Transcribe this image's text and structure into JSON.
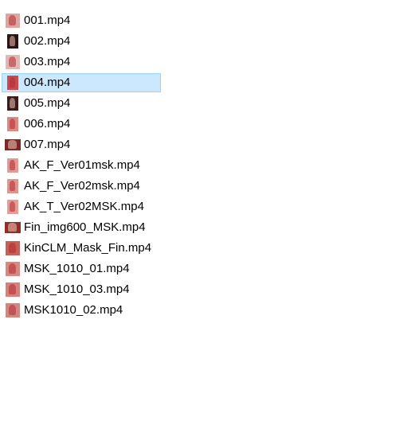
{
  "files": [
    {
      "name": "001.mp4",
      "thumb": "video-thumbnail",
      "thumb_color": "#e0a59e",
      "thumb_style": "square",
      "selected": false
    },
    {
      "name": "002.mp4",
      "thumb": "video-thumbnail",
      "thumb_color": "#2a1412",
      "thumb_style": "tall",
      "selected": false
    },
    {
      "name": "003.mp4",
      "thumb": "video-thumbnail",
      "thumb_color": "#e3b8b4",
      "thumb_style": "square",
      "selected": false
    },
    {
      "name": "004.mp4",
      "thumb": "video-thumbnail",
      "thumb_color": "#c84a4e",
      "thumb_style": "tall",
      "selected": true
    },
    {
      "name": "005.mp4",
      "thumb": "video-thumbnail",
      "thumb_color": "#3a1d1a",
      "thumb_style": "tall",
      "selected": false
    },
    {
      "name": "006.mp4",
      "thumb": "video-thumbnail",
      "thumb_color": "#dc8a80",
      "thumb_style": "tall",
      "selected": false
    },
    {
      "name": "007.mp4",
      "thumb": "video-thumbnail",
      "thumb_color": "#7a2a24",
      "thumb_style": "wide",
      "selected": false
    },
    {
      "name": "AK_F_Ver01msk.mp4",
      "thumb": "video-thumbnail",
      "thumb_color": "#e29a92",
      "thumb_style": "tall",
      "selected": false
    },
    {
      "name": "AK_F_Ver02msk.mp4",
      "thumb": "video-thumbnail",
      "thumb_color": "#e0948c",
      "thumb_style": "tall",
      "selected": false
    },
    {
      "name": "AK_T_Ver02MSK.mp4",
      "thumb": "video-thumbnail",
      "thumb_color": "#e49c94",
      "thumb_style": "tall",
      "selected": false
    },
    {
      "name": "Fin_img600_MSK.mp4",
      "thumb": "video-thumbnail",
      "thumb_color": "#8c3028",
      "thumb_style": "wide",
      "selected": false
    },
    {
      "name": "KinCLM_Mask_Fin.mp4",
      "thumb": "video-thumbnail",
      "thumb_color": "#c8605a",
      "thumb_style": "square",
      "selected": false
    },
    {
      "name": "MSK_1010_01.mp4",
      "thumb": "video-thumbnail",
      "thumb_color": "#d88880",
      "thumb_style": "square",
      "selected": false
    },
    {
      "name": "MSK_1010_03.mp4",
      "thumb": "video-thumbnail",
      "thumb_color": "#d6827a",
      "thumb_style": "square",
      "selected": false
    },
    {
      "name": "MSK1010_02.mp4",
      "thumb": "video-thumbnail",
      "thumb_color": "#d4867e",
      "thumb_style": "square",
      "selected": false
    }
  ],
  "colors": {
    "selection_background": "#cce8ff",
    "selection_border": "#99d1ff",
    "text": "#000000",
    "background": "#ffffff"
  }
}
